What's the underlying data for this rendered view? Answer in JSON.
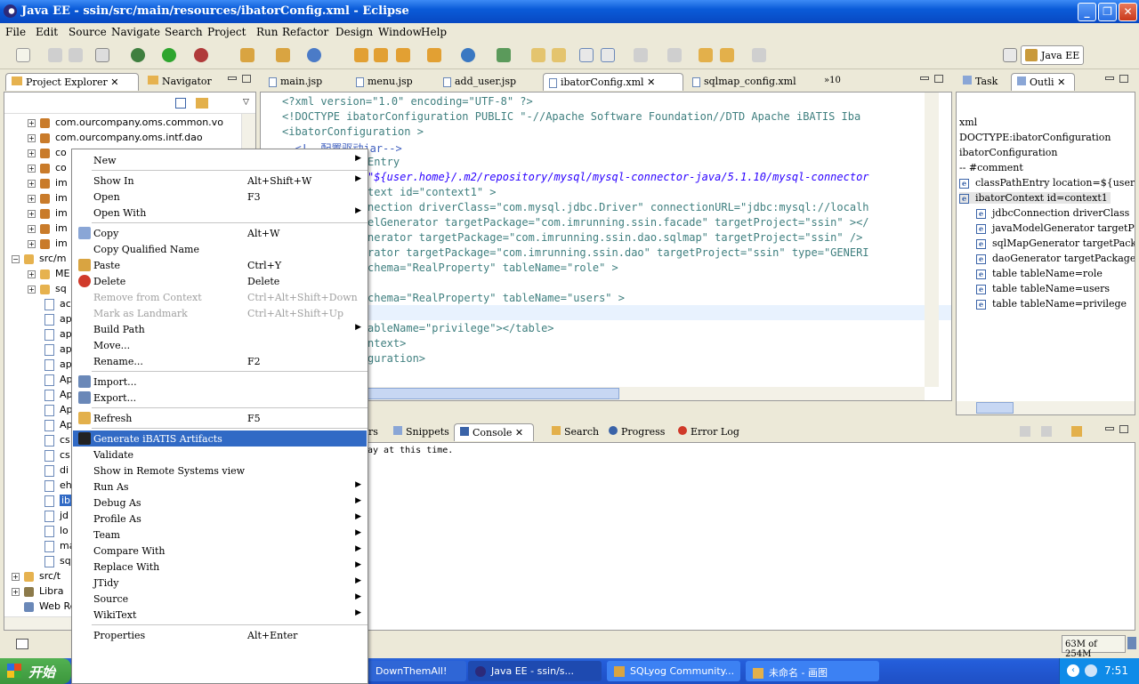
{
  "window": {
    "title": "Java EE - ssin/src/main/resources/ibatorConfig.xml - Eclipse"
  },
  "menu": [
    "File",
    "Edit",
    "Source",
    "Navigate",
    "Search",
    "Project",
    "Run",
    "Refactor",
    "Design",
    "Window",
    "Help"
  ],
  "perspective": "Java EE",
  "left_tabs": [
    "Project Explorer",
    "Navigator"
  ],
  "tree_top": [
    "com.ourcompany.oms.common.vo",
    "com.ourcompany.oms.intf.dao",
    "co",
    "co",
    "im",
    "im",
    "im",
    "im",
    "im"
  ],
  "tree_src": "src/m",
  "tree_mid": [
    "ME",
    "sq",
    "ac",
    "ap",
    "ap",
    "ap",
    "ap",
    "Ap",
    "Ap",
    "Ap",
    "Ap",
    "cs",
    "cs",
    "di",
    "eh",
    "ib",
    "jd",
    "lo",
    "ma",
    "sq"
  ],
  "tree_bottom": [
    "src/t",
    "Libra",
    "Web Resou"
  ],
  "editor_tabs": [
    "main.jsp",
    "menu.jsp",
    "add_user.jsp",
    "ibatorConfig.xml",
    "sqlmap_config.xml",
    "»10"
  ],
  "code": [
    "<?xml version=\"1.0\" encoding=\"UTF-8\" ?>",
    "<!DOCTYPE ibatorConfiguration PUBLIC \"-//Apache Software Foundation//DTD Apache iBATIS Iba",
    "<ibatorConfiguration >",
    "  <!--配置驱动jar-->",
    "Entry",
    "\"${user.home}/.m2/repository/mysql/mysql-connector-java/5.1.10/mysql-connector",
    "text id=\"context1\" >",
    "nection driverClass=\"com.mysql.jdbc.Driver\" connectionURL=\"jdbc:mysql://localh",
    "elGenerator targetPackage=\"com.imrunning.ssin.facade\" targetProject=\"ssin\" ></",
    "nerator targetPackage=\"com.imrunning.ssin.dao.sqlmap\" targetProject=\"ssin\" />",
    "rator targetPackage=\"com.imrunning.ssin.dao\" targetProject=\"ssin\" type=\"GENERI",
    "chema=\"RealProperty\" tableName=\"role\" >",
    "",
    "chema=\"RealProperty\" tableName=\"users\" >",
    "",
    "ableName=\"privilege\"></table>",
    "ntext>",
    "guration>"
  ],
  "right_tabs": [
    "Task",
    "Outli"
  ],
  "outline": [
    "xml",
    "DOCTYPE:ibatorConfiguration",
    "ibatorConfiguration",
    "-- #comment",
    "classPathEntry location=${user",
    "ibatorContext id=context1",
    "jdbcConnection driverClass",
    "javaModelGenerator targetP",
    "sqlMapGenerator targetPack",
    "daoGenerator targetPackage",
    "table tableName=role",
    "table tableName=users",
    "table tableName=privilege"
  ],
  "bottom_tabs": [
    "rs",
    "Snippets",
    "Console",
    "Search",
    "Progress",
    "Error Log"
  ],
  "console_text": "ay at this time.",
  "context_menu": [
    {
      "label": "New",
      "arrow": true
    },
    {
      "sep": true
    },
    {
      "label": "Show In",
      "shortcut": "Alt+Shift+W",
      "arrow": true
    },
    {
      "label": "Open",
      "shortcut": "F3"
    },
    {
      "label": "Open With",
      "arrow": true
    },
    {
      "sep": true
    },
    {
      "label": "Copy",
      "shortcut": "Alt+W",
      "icon": "copy"
    },
    {
      "label": "Copy Qualified Name"
    },
    {
      "label": "Paste",
      "shortcut": "Ctrl+Y",
      "icon": "paste"
    },
    {
      "label": "Delete",
      "shortcut": "Delete",
      "icon": "delete"
    },
    {
      "label": "Remove from Context",
      "shortcut": "Ctrl+Alt+Shift+Down",
      "disabled": true
    },
    {
      "label": "Mark as Landmark",
      "shortcut": "Ctrl+Alt+Shift+Up",
      "disabled": true
    },
    {
      "label": "Build Path",
      "arrow": true
    },
    {
      "label": "Move..."
    },
    {
      "label": "Rename...",
      "shortcut": "F2"
    },
    {
      "sep": true
    },
    {
      "label": "Import...",
      "icon": "import"
    },
    {
      "label": "Export...",
      "icon": "export"
    },
    {
      "sep": true
    },
    {
      "label": "Refresh",
      "shortcut": "F5",
      "icon": "refresh"
    },
    {
      "sep": true
    },
    {
      "label": "Generate iBATIS Artifacts",
      "selected": true,
      "icon": "ibatis"
    },
    {
      "label": "Validate"
    },
    {
      "label": "Show in Remote Systems view"
    },
    {
      "label": "Run As",
      "arrow": true
    },
    {
      "label": "Debug As",
      "arrow": true
    },
    {
      "label": "Profile As",
      "arrow": true
    },
    {
      "label": "Team",
      "arrow": true
    },
    {
      "label": "Compare With",
      "arrow": true
    },
    {
      "label": "Replace With",
      "arrow": true
    },
    {
      "label": "JTidy",
      "arrow": true
    },
    {
      "label": "Source",
      "arrow": true
    },
    {
      "label": "WikiText",
      "arrow": true
    },
    {
      "sep": true
    },
    {
      "label": "Properties",
      "shortcut": "Alt+Enter"
    }
  ],
  "status": {
    "memory": "63M of 254M"
  },
  "taskbar": {
    "start": "开始",
    "tasks": [
      "DownThemAll!",
      "Java EE - ssin/s...",
      "SQLyog Community...",
      "未命名 - 画图"
    ],
    "clock": "7:51"
  },
  "colors": {
    "titlebar": "#0a5bd8",
    "selection": "#316ac5",
    "taskbar": "#245edb"
  }
}
